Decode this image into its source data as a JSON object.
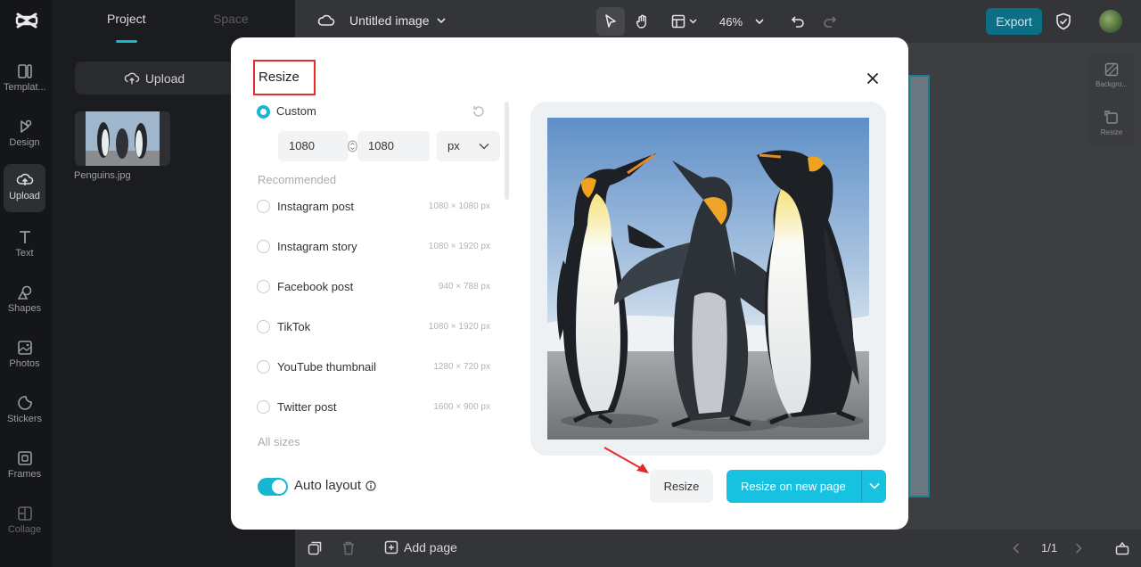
{
  "app": {
    "document_title": "Untitled image",
    "zoom": "46%",
    "export_label": "Export",
    "page_indicator": "1/1",
    "add_page_label": "Add page"
  },
  "rail": {
    "items": [
      {
        "label": "Templat...",
        "icon": "template-icon"
      },
      {
        "label": "Design",
        "icon": "design-icon"
      },
      {
        "label": "Upload",
        "icon": "upload-cloud-icon"
      },
      {
        "label": "Text",
        "icon": "text-icon"
      },
      {
        "label": "Shapes",
        "icon": "shapes-icon"
      },
      {
        "label": "Photos",
        "icon": "photos-icon"
      },
      {
        "label": "Stickers",
        "icon": "stickers-icon"
      },
      {
        "label": "Frames",
        "icon": "frames-icon"
      },
      {
        "label": "Collage",
        "icon": "collage-icon"
      }
    ],
    "active_index": 2
  },
  "panel": {
    "tabs": [
      "Project",
      "Space"
    ],
    "upload_label": "Upload",
    "file_name": "Penguins.jpg"
  },
  "right_tools": {
    "background_label": "Backgro...",
    "resize_label": "Resize"
  },
  "modal": {
    "title": "Resize",
    "custom_label": "Custom",
    "width_value": "1080",
    "height_value": "1080",
    "unit": "px",
    "recommended_label": "Recommended",
    "options": [
      {
        "name": "Instagram post",
        "dims": "1080 × 1080 px"
      },
      {
        "name": "Instagram story",
        "dims": "1080 × 1920 px"
      },
      {
        "name": "Facebook post",
        "dims": "940 × 788 px"
      },
      {
        "name": "TikTok",
        "dims": "1080 × 1920 px"
      },
      {
        "name": "YouTube thumbnail",
        "dims": "1280 × 720 px"
      },
      {
        "name": "Twitter post",
        "dims": "1600 × 900 px"
      }
    ],
    "all_sizes_label": "All sizes",
    "auto_layout_label": "Auto layout",
    "auto_layout_on": true,
    "resize_button": "Resize",
    "resize_new_page_button": "Resize on new page"
  },
  "colors": {
    "accent": "#17b6d3",
    "primary_button": "#17c2e0",
    "annotation_red": "#e52a2a"
  }
}
